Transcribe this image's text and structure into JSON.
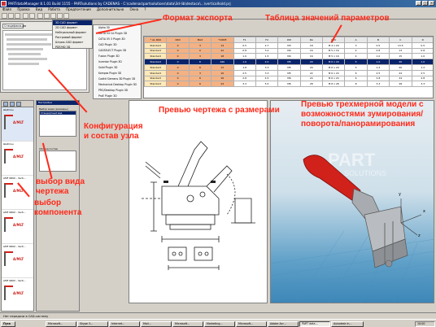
{
  "window": {
    "title": "PARTdataManager 8.1.01 Build 1155 - PARTsolutions by CADENAS - C:\\cadenas\\partsolutions\\data\\3d-lib\\destaco\\...\\verticalhold.prj"
  },
  "menu": {
    "items": [
      "Файл",
      "Правка",
      "Вид",
      "Работа",
      "Предпочтения",
      "Дополнительно",
      "Окна",
      "?"
    ]
  },
  "left_panel": {
    "tab_label": "Спецификация"
  },
  "export_menu": {
    "items": [
      "3D CAD формат",
      "2D CAD формат",
      "Нейтральный формат",
      "Растровый формат",
      "Штрих-CAD формат",
      "PDF/HD 3D"
    ],
    "submenu": [
      "Alpha 30",
      "CATIA V4 CA Plugin 3D",
      "CATIA V5 3 Plugin 3D",
      "CAD Plugin 3D",
      "CADSELECT Plugin 3D",
      "Fusion Plugin 3D",
      "Inventor Plugin 3D",
      "Solid Plugin 3D",
      "Kompas Plugin 3D",
      "Cadkit Siemens 3D Plugin 3D",
      "Mechanical Desktop Plugin 3D",
      "PRO/Desktop Plugin 3D",
      "ProE Plugin 3D"
    ]
  },
  "table": {
    "headers": [
      "* AL PAN",
      "CRD",
      "MAX",
      "*CODE",
      "F1",
      "F2",
      "DM",
      "RA",
      "CRV",
      "A",
      "B",
      "C",
      "D"
    ],
    "rows": [
      [
        "Standard",
        "0",
        "3",
        "14",
        "0.5",
        "2.7",
        "M3",
        "18",
        "M 4 x 20",
        "3",
        "0.5",
        "13.5",
        "0.5"
      ],
      [
        "Standard",
        "0",
        "0",
        "22",
        "0.8",
        "3.2",
        "M4",
        "16",
        "M 5 x 16",
        "4",
        "0.8",
        "13",
        "0.8"
      ],
      [
        "Standard",
        "0",
        "3",
        "18",
        "1.0",
        "1.5",
        "M4",
        "16",
        "M 5 x 16",
        "4",
        "1.0",
        "15",
        "1.0"
      ],
      [
        "Standard",
        "0",
        "6",
        "160",
        "1.0",
        "4.0",
        "M5",
        "20",
        "M 6 x 20",
        "5",
        "1.0",
        "20",
        "1.0"
      ],
      [
        "Standard",
        "0",
        "6",
        "12",
        "1.8",
        "3.3",
        "M5",
        "20",
        "M 6 x 20",
        "5",
        "1.2",
        "20",
        "1.2"
      ],
      [
        "Standard",
        "0",
        "3",
        "10",
        "2.5",
        "3.3",
        "M5",
        "22",
        "M 6 x 24",
        "6",
        "2.5",
        "24",
        "2.5"
      ],
      [
        "Standard",
        "0",
        "6",
        "16",
        "2.8",
        "4.5",
        "M6",
        "24",
        "M 6 x 24",
        "6",
        "2.8",
        "24",
        "2.8"
      ],
      [
        "Standard",
        "0",
        "6",
        "24",
        "3.3",
        "5.5",
        "M6",
        "28",
        "M 8 x 28",
        "8",
        "3.3",
        "28",
        "3.3"
      ]
    ]
  },
  "config_panel": {
    "title": "Настройки",
    "section1": "Выбор вида (размеры)",
    "item1": "Стандартный вид",
    "section2": "Сборка/состав"
  },
  "thumbs": {
    "items": [
      {
        "title": "Шаблон",
        "code": "A/MLT"
      },
      {
        "title": "Шаблон",
        "code": "A/MLT"
      },
      {
        "title": "AMF 6800 - Verti...",
        "code": "A/MLT"
      },
      {
        "title": "AMF 6800 - Verti...",
        "code": "A/MLT"
      },
      {
        "title": "AMF 6800 - Verti...",
        "code": "A/MLT"
      },
      {
        "title": "AMF 6800 - Verti...",
        "code": "A/MLT"
      }
    ]
  },
  "drawing": {
    "tab": "Чертёж"
  },
  "viewer3d": {
    "tab": "3D модель",
    "watermark1": "PART",
    "watermark2": "SOLUTIONS",
    "axis_x": "x",
    "axis_y": "y",
    "axis_z": "z"
  },
  "callouts": {
    "export": "Формат экспорта",
    "table": "Таблица значений параметров",
    "config": "Конфигурация\nи состав узла",
    "preview2d": "Превью чертежа с размерами",
    "preview3d": "Превью трехмерной модели с\nвозможностями зумирования/\nповорота/панорамирования",
    "view": "выбор вида\nчертежа",
    "component": "выбор\nкомпонента"
  },
  "statusbar": {
    "text": "Нет передачи в CAD-систему"
  },
  "taskbar": {
    "start": "Пуск",
    "tasks": [
      "Microsoft...",
      "Skype 3...",
      "Internet...",
      "Mail...",
      "Microsoft...",
      "Marketing...",
      "Microsoft...",
      "Adobe Acr...",
      "PART data...",
      "Autodesk In..."
    ],
    "clock": "10:00"
  },
  "colors": {
    "accent_red": "#ff2a1a",
    "row_selected": "#0a246a",
    "header_orange": "#f4b183",
    "title_blue": "#0a246a"
  }
}
